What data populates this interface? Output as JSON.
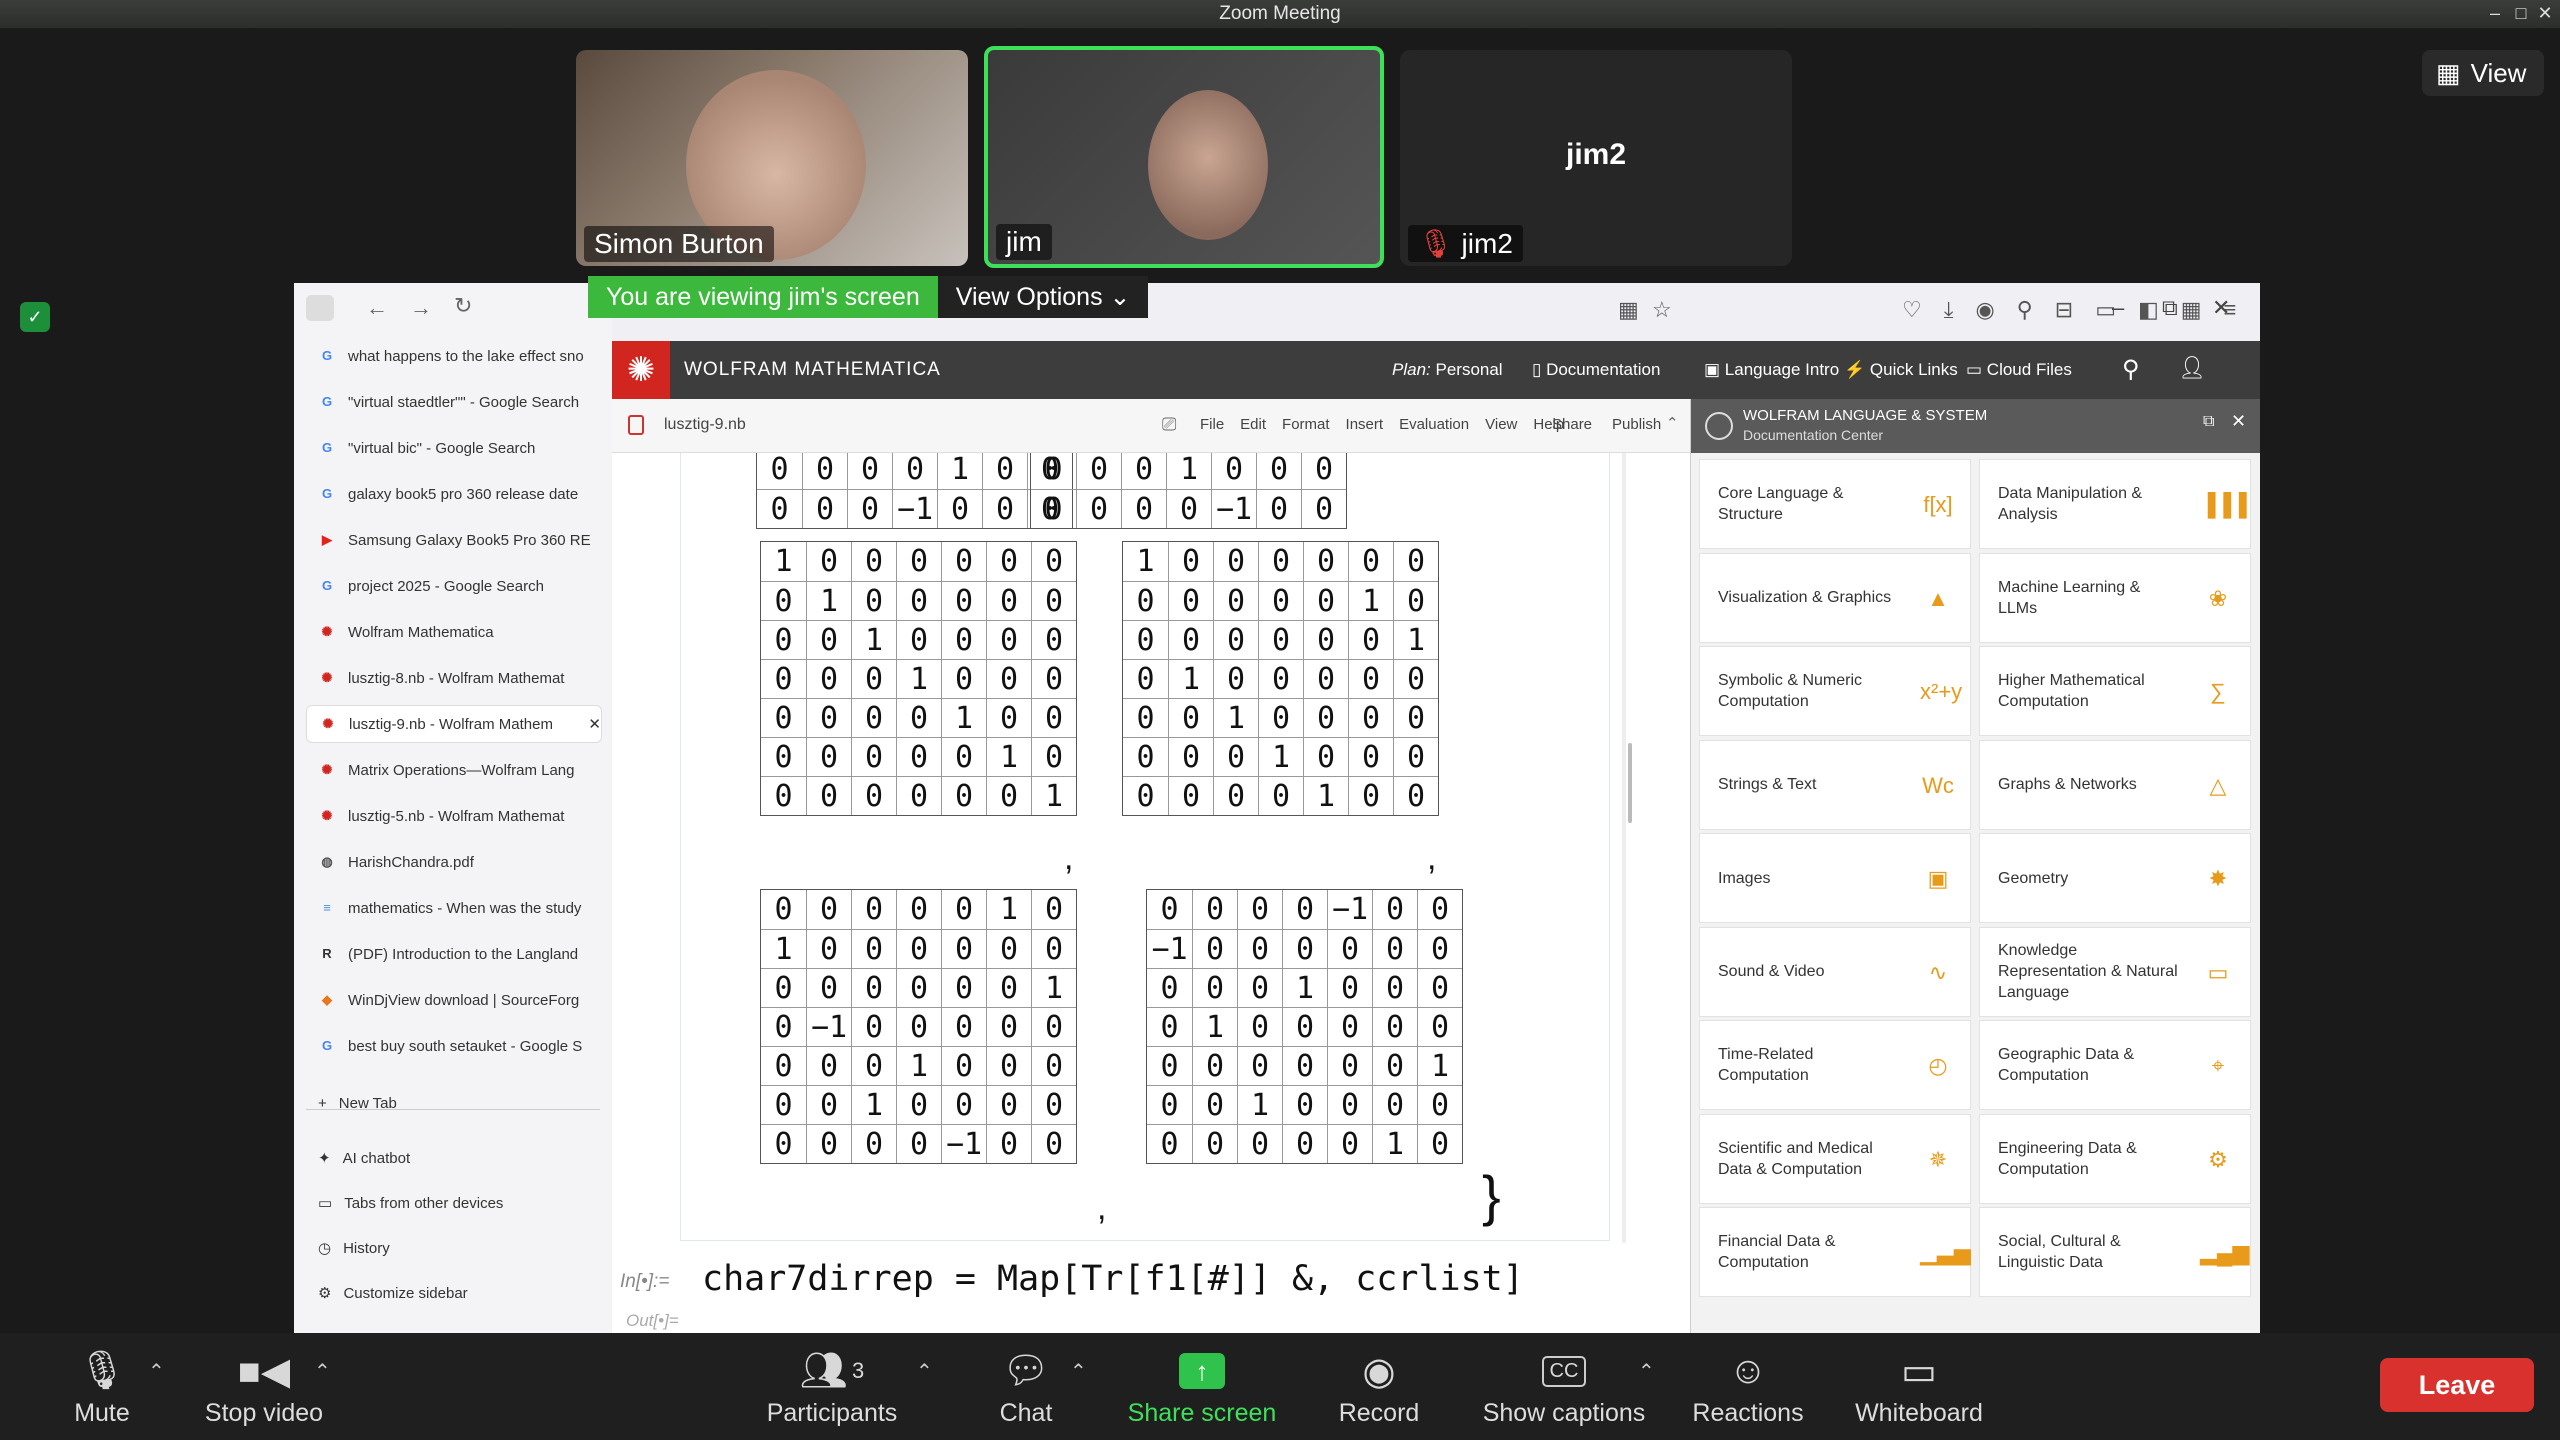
{
  "zoom": {
    "window_title": "Zoom Meeting",
    "view_button": "View",
    "participants_tiles": [
      {
        "name": "Simon Burton"
      },
      {
        "name": "jim"
      },
      {
        "name": "jim2",
        "center_label": "jim2"
      }
    ],
    "banner": {
      "viewing": "You are viewing jim's screen",
      "options": "View Options"
    },
    "toolbar": {
      "mute": "Mute",
      "stop_video": "Stop video",
      "participants": "Participants",
      "participants_count": "3",
      "chat": "Chat",
      "share_screen": "Share screen",
      "record": "Record",
      "show_captions": "Show captions",
      "reactions": "Reactions",
      "whiteboard": "Whiteboard",
      "leave": "Leave"
    },
    "colors": {
      "share_green": "#3cb83c",
      "leave_red": "#d9322e"
    }
  },
  "browser": {
    "url": "https://www.wolframcloud.com/env/jdolan/lusztig-9.nb",
    "tabs": [
      {
        "label": "what happens to the lake effect sno",
        "icon": "G"
      },
      {
        "label": "\"virtual staedtler\"\" - Google Search",
        "icon": "G"
      },
      {
        "label": "\"virtual bic\" - Google Search",
        "icon": "G"
      },
      {
        "label": "galaxy book5 pro 360 release date",
        "icon": "G"
      },
      {
        "label": "Samsung Galaxy Book5 Pro 360 RE",
        "icon": "▶"
      },
      {
        "label": "project 2025 - Google Search",
        "icon": "G"
      },
      {
        "label": "Wolfram Mathematica",
        "icon": "✺"
      },
      {
        "label": "lusztig-8.nb - Wolfram Mathemat",
        "icon": "✺"
      },
      {
        "label": "lusztig-9.nb - Wolfram Mathem",
        "icon": "✺"
      },
      {
        "label": "Matrix Operations—Wolfram Lang",
        "icon": "✺"
      },
      {
        "label": "lusztig-5.nb - Wolfram Mathemat",
        "icon": "✺"
      },
      {
        "label": "HarishChandra.pdf",
        "icon": "◍"
      },
      {
        "label": "mathematics - When was the study",
        "icon": "≡"
      },
      {
        "label": "(PDF) Introduction to the Langland",
        "icon": "R"
      },
      {
        "label": "WinDjView download | SourceForg",
        "icon": "◆"
      },
      {
        "label": "best buy south setauket - Google S",
        "icon": "G"
      }
    ],
    "new_tab": "New Tab",
    "ai_chatbot": "AI chatbot",
    "other_devices": "Tabs from other devices",
    "history": "History",
    "customize": "Customize sidebar"
  },
  "wolfram": {
    "brand": "WOLFRAM MATHEMATICA",
    "plan_label": "Plan:",
    "plan_value": "Personal",
    "nav": [
      "Documentation",
      "Language Intro",
      "Quick Links",
      "Cloud Files"
    ],
    "notebook_name": "lusztig-9.nb",
    "menu": [
      "File",
      "Edit",
      "Format",
      "Insert",
      "Evaluation",
      "View",
      "Help"
    ],
    "share": "Share",
    "publish": "Publish",
    "input_label": "In[•]:=",
    "output_label": "Out[•]=",
    "input_code": "char7dirrep = Map[Tr[f1[#]] &, ccrlist]",
    "closing_brace": "}",
    "comma": ",",
    "matrices_top": [
      [
        [
          "0",
          "0",
          "0",
          "0",
          "1",
          "0",
          "0"
        ],
        [
          "0",
          "0",
          "0",
          "−1",
          "0",
          "0",
          "0"
        ]
      ],
      [
        [
          "0",
          "0",
          "0",
          "1",
          "0",
          "0",
          "0"
        ],
        [
          "0",
          "0",
          "0",
          "0",
          "−1",
          "0",
          "0"
        ]
      ]
    ],
    "matrices_mid": [
      [
        [
          "1",
          "0",
          "0",
          "0",
          "0",
          "0",
          "0"
        ],
        [
          "0",
          "1",
          "0",
          "0",
          "0",
          "0",
          "0"
        ],
        [
          "0",
          "0",
          "1",
          "0",
          "0",
          "0",
          "0"
        ],
        [
          "0",
          "0",
          "0",
          "1",
          "0",
          "0",
          "0"
        ],
        [
          "0",
          "0",
          "0",
          "0",
          "1",
          "0",
          "0"
        ],
        [
          "0",
          "0",
          "0",
          "0",
          "0",
          "1",
          "0"
        ],
        [
          "0",
          "0",
          "0",
          "0",
          "0",
          "0",
          "1"
        ]
      ],
      [
        [
          "1",
          "0",
          "0",
          "0",
          "0",
          "0",
          "0"
        ],
        [
          "0",
          "0",
          "0",
          "0",
          "0",
          "1",
          "0"
        ],
        [
          "0",
          "0",
          "0",
          "0",
          "0",
          "0",
          "1"
        ],
        [
          "0",
          "1",
          "0",
          "0",
          "0",
          "0",
          "0"
        ],
        [
          "0",
          "0",
          "1",
          "0",
          "0",
          "0",
          "0"
        ],
        [
          "0",
          "0",
          "0",
          "1",
          "0",
          "0",
          "0"
        ],
        [
          "0",
          "0",
          "0",
          "0",
          "1",
          "0",
          "0"
        ]
      ]
    ],
    "matrices_bottom": [
      [
        [
          "0",
          "0",
          "0",
          "0",
          "0",
          "1",
          "0"
        ],
        [
          "1",
          "0",
          "0",
          "0",
          "0",
          "0",
          "0"
        ],
        [
          "0",
          "0",
          "0",
          "0",
          "0",
          "0",
          "1"
        ],
        [
          "0",
          "−1",
          "0",
          "0",
          "0",
          "0",
          "0"
        ],
        [
          "0",
          "0",
          "0",
          "1",
          "0",
          "0",
          "0"
        ],
        [
          "0",
          "0",
          "1",
          "0",
          "0",
          "0",
          "0"
        ],
        [
          "0",
          "0",
          "0",
          "0",
          "−1",
          "0",
          "0"
        ]
      ],
      [
        [
          "0",
          "0",
          "0",
          "0",
          "−1",
          "0",
          "0"
        ],
        [
          "−1",
          "0",
          "0",
          "0",
          "0",
          "0",
          "0"
        ],
        [
          "0",
          "0",
          "0",
          "1",
          "0",
          "0",
          "0"
        ],
        [
          "0",
          "1",
          "0",
          "0",
          "0",
          "0",
          "0"
        ],
        [
          "0",
          "0",
          "0",
          "0",
          "0",
          "0",
          "1"
        ],
        [
          "0",
          "0",
          "1",
          "0",
          "0",
          "0",
          "0"
        ],
        [
          "0",
          "0",
          "0",
          "0",
          "0",
          "1",
          "0"
        ]
      ]
    ],
    "doc_panel": {
      "title_line1": "WOLFRAM LANGUAGE & SYSTEM",
      "title_line2": "Documentation Center",
      "cards": [
        {
          "label": "Core Language & Structure",
          "icon": "f[x]"
        },
        {
          "label": "Data Manipulation & Analysis",
          "icon": "▐▐▐"
        },
        {
          "label": "Visualization & Graphics",
          "icon": "▲"
        },
        {
          "label": "Machine Learning & LLMs",
          "icon": "❀"
        },
        {
          "label": "Symbolic & Numeric Computation",
          "icon": "x²+y"
        },
        {
          "label": "Higher Mathematical Computation",
          "icon": "∑"
        },
        {
          "label": "Strings & Text",
          "icon": "Wc"
        },
        {
          "label": "Graphs & Networks",
          "icon": "△"
        },
        {
          "label": "Images",
          "icon": "▣"
        },
        {
          "label": "Geometry",
          "icon": "✸"
        },
        {
          "label": "Sound & Video",
          "icon": "∿"
        },
        {
          "label": "Knowledge Representation & Natural Language",
          "icon": "▭"
        },
        {
          "label": "Time-Related Computation",
          "icon": "◴"
        },
        {
          "label": "Geographic Data & Computation",
          "icon": "⌖"
        },
        {
          "label": "Scientific and Medical Data & Computation",
          "icon": "✵"
        },
        {
          "label": "Engineering Data & Computation",
          "icon": "⚙"
        },
        {
          "label": "Financial Data & Computation",
          "icon": "▁▃▅"
        },
        {
          "label": "Social, Cultural & Linguistic Data",
          "icon": "▂▄▆"
        }
      ]
    }
  }
}
